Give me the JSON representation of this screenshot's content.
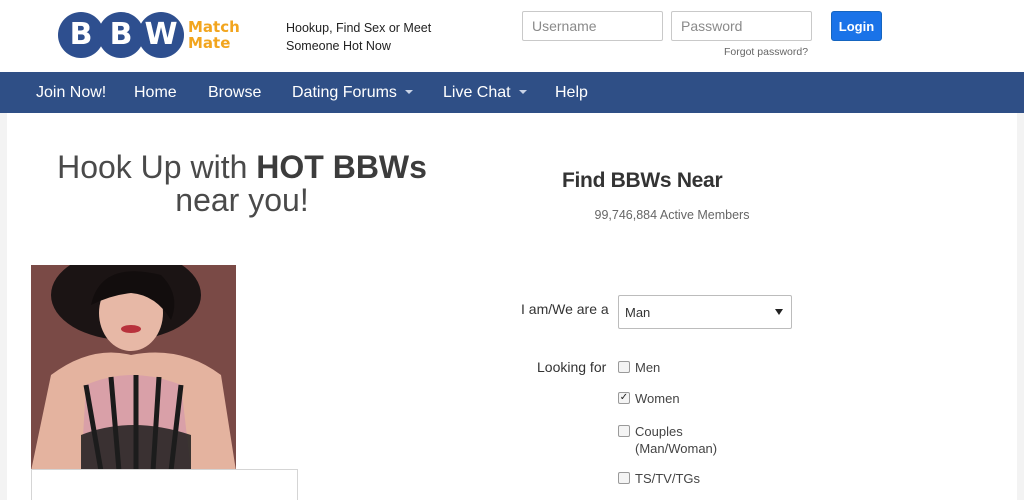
{
  "header": {
    "logo": {
      "letters": [
        "B",
        "B",
        "W"
      ],
      "word1": "Match",
      "word2": "Mate"
    },
    "tagline": [
      "Hookup, Find Sex or Meet",
      "Someone Hot Now"
    ],
    "login": {
      "username_placeholder": "Username",
      "password_placeholder": "Password",
      "button_label": "Login",
      "forgot_label": "Forgot password?"
    }
  },
  "nav": {
    "items": [
      {
        "label": "Join Now!",
        "dropdown": false
      },
      {
        "label": "Home",
        "dropdown": false
      },
      {
        "label": "Browse",
        "dropdown": false
      },
      {
        "label": "Dating Forums",
        "dropdown": true
      },
      {
        "label": "Live Chat",
        "dropdown": true
      },
      {
        "label": "Help",
        "dropdown": false
      }
    ]
  },
  "hero": {
    "line1_prefix": "Hook Up with ",
    "line1_bold": "HOT BBWs",
    "line2": "near you!"
  },
  "search": {
    "title": "Find BBWs Near",
    "members": "99,746,884 Active Members",
    "iam_label": "I am/We are a",
    "iam_value": "Man",
    "looking_label": "Looking for",
    "options": [
      {
        "label": "Men",
        "checked": false
      },
      {
        "label": "Women",
        "checked": true
      },
      {
        "label": "Couples",
        "sub": "(Man/Woman)",
        "checked": false
      },
      {
        "label": "TS/TV/TGs",
        "checked": false
      }
    ]
  },
  "colors": {
    "nav_bg": "#2f4f86",
    "logo_blue": "#2e4f8f",
    "logo_orange": "#f2a51e",
    "login_button": "#1a73e8"
  }
}
